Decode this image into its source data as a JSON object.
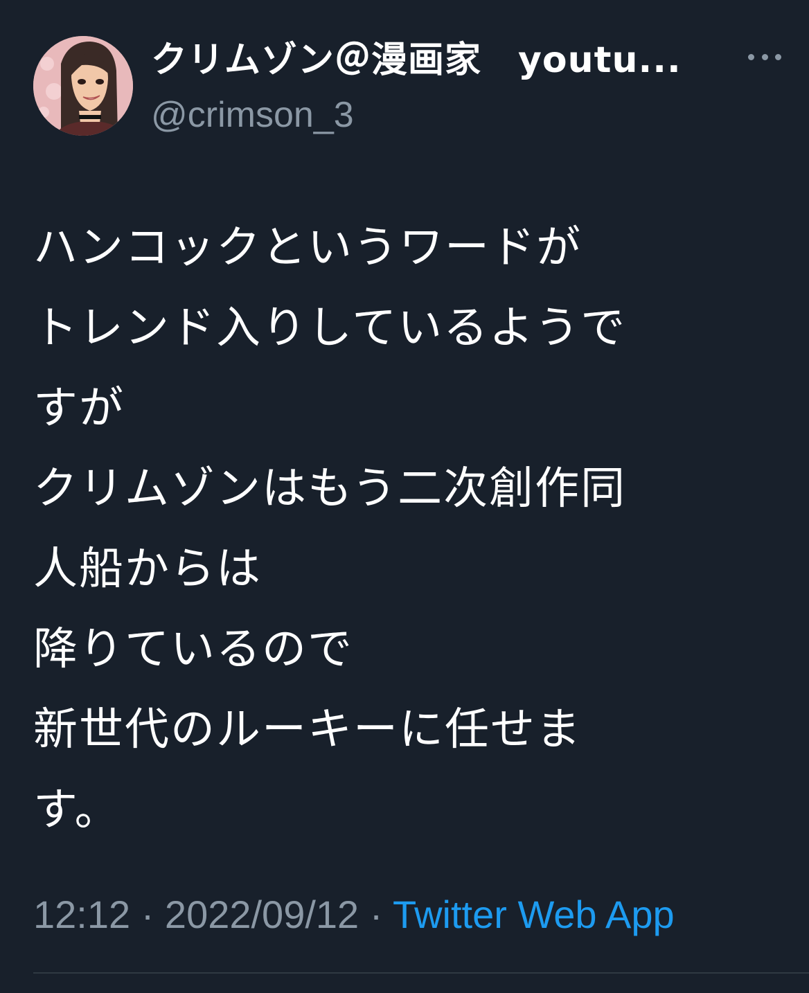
{
  "author": {
    "display_name": "クリムゾン＠漫画家　youtu...",
    "handle": "@crimson_3",
    "avatar_icon": "avatar-illustration"
  },
  "tweet": {
    "lines": [
      "ハンコックというワードが",
      "トレンド入りしているようで",
      "すが",
      "クリムゾンはもう二次創作同",
      "人船からは",
      "降りているので",
      "新世代のルーキーに任せま",
      "す。"
    ],
    "time": "12:12",
    "separator": "·",
    "date": "2022/09/12",
    "source": "Twitter Web App"
  },
  "more_icon": "more-horizontal-icon",
  "colors": {
    "background": "#18202b",
    "text": "#ffffff",
    "muted": "#8b98a5",
    "link": "#1d9bf0",
    "divider": "#2f3942"
  }
}
